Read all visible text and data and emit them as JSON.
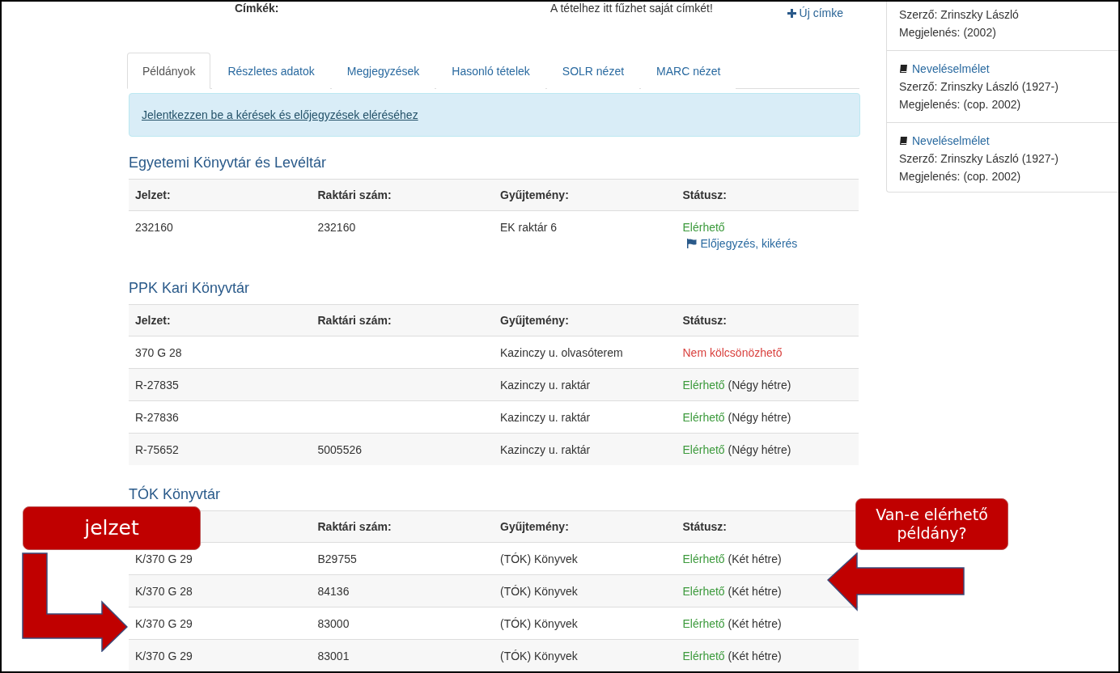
{
  "tags_row": {
    "label": "Címkék:",
    "hint": "A tételhez itt fűzhet saját címkét!",
    "add_button": "Új címke"
  },
  "tabs": [
    {
      "label": "Példányok",
      "selected": true
    },
    {
      "label": "Részletes adatok",
      "selected": false
    },
    {
      "label": "Megjegyzések",
      "selected": false
    },
    {
      "label": "Hasonló tételek",
      "selected": false
    },
    {
      "label": "SOLR nézet",
      "selected": false
    },
    {
      "label": "MARC nézet",
      "selected": false
    }
  ],
  "alert": {
    "link": "Jelentkezzen be a kérések és előjegyzések eléréséhez"
  },
  "libraries": [
    {
      "name": "Egyetemi Könyvtár és Levéltár",
      "columns": [
        "Jelzet:",
        "Raktári szám:",
        "Gyűjtemény:",
        "Státusz:"
      ],
      "rows": [
        {
          "call_number": "232160",
          "barcode": "232160",
          "collection": "EK raktár 6",
          "status": {
            "kind": "available",
            "label": "Elérhető",
            "link": "Előjegyzés, kikérés"
          }
        }
      ]
    },
    {
      "name": "PPK Kari Könyvtár",
      "columns": [
        "Jelzet:",
        "Raktári szám:",
        "Gyűjtemény:",
        "Státusz:"
      ],
      "rows": [
        {
          "call_number": "370 G 28",
          "collection": "Kazinczy u. olvasóterem",
          "status": {
            "kind": "unavailable",
            "label": "Nem kölcsönözhető"
          }
        },
        {
          "call_number": "R-27835",
          "collection": "Kazinczy u. raktár",
          "status": {
            "kind": "available",
            "label": "Elérhető",
            "note": "(Négy hétre)"
          }
        },
        {
          "call_number": "R-27836",
          "collection": "Kazinczy u. raktár",
          "status": {
            "kind": "available",
            "label": "Elérhető",
            "note": "(Négy hétre)"
          }
        },
        {
          "call_number": "R-75652",
          "barcode": "5005526",
          "collection": "Kazinczy u. raktár",
          "status": {
            "kind": "available",
            "label": "Elérhető",
            "note": "(Négy hétre)"
          }
        }
      ]
    },
    {
      "name": "TÓK Könyvtár",
      "columns": [
        "Raktári szám:",
        "Gyűjtemény:",
        "Státusz:"
      ],
      "rows": [
        {
          "call_number": "K/370 G 29",
          "barcode": "B29755",
          "collection": "(TÓK) Könyvek",
          "status": {
            "kind": "available",
            "label": "Elérhető",
            "note": "(Két hétre)"
          }
        },
        {
          "call_number": "K/370 G 28",
          "barcode": "84136",
          "collection": "(TÓK) Könyvek",
          "status": {
            "kind": "available",
            "label": "Elérhető",
            "note": "(Két hétre)"
          }
        },
        {
          "call_number": "K/370 G 29",
          "barcode": "83000",
          "collection": "(TÓK) Könyvek",
          "status": {
            "kind": "available",
            "label": "Elérhető",
            "note": "(Két hétre)"
          }
        },
        {
          "call_number": "K/370 G 29",
          "barcode": "83001",
          "collection": "(TÓK) Könyvek",
          "status": {
            "kind": "available",
            "label": "Elérhető",
            "note": "(Két hétre)"
          }
        }
      ]
    }
  ],
  "similar_items": [
    {
      "author": "Szerző: Zrinszky László",
      "published": "Megjelenés: (2002)"
    },
    {
      "title": "Neveléselmélet",
      "author": "Szerző: Zrinszky László (1927-)",
      "published": "Megjelenés: (cop. 2002)"
    },
    {
      "title": "Neveléselmélet",
      "author": "Szerző: Zrinszky László (1927-)",
      "published": "Megjelenés: (cop. 2002)"
    }
  ],
  "callouts": [
    {
      "text": "jelzet"
    },
    {
      "text": "Van-e elérhető példány?"
    }
  ]
}
